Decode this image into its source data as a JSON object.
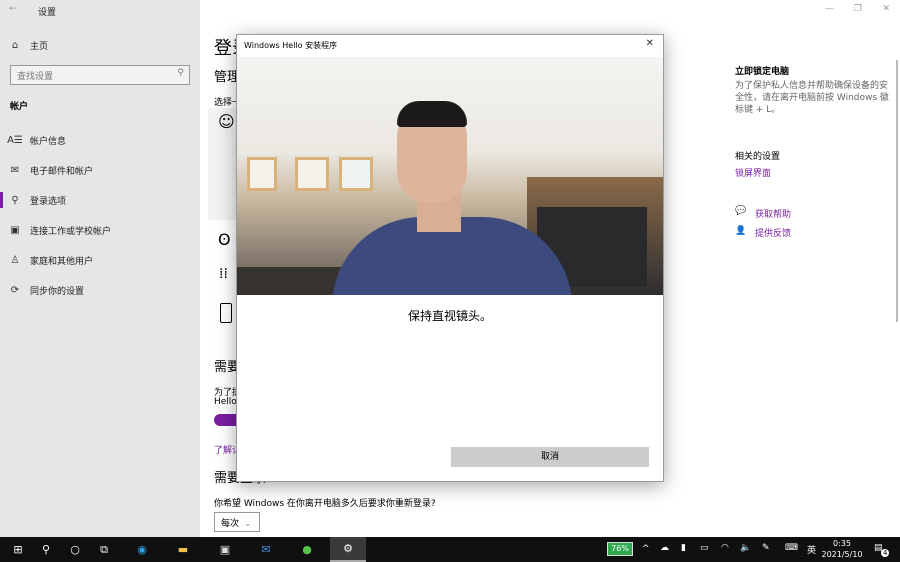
{
  "window": {
    "title": "设置",
    "back": "←",
    "min": "—",
    "restore": "❐",
    "close": "✕"
  },
  "sidebar": {
    "home": "主页",
    "search_placeholder": "查找设置",
    "section": "帐户",
    "items": [
      {
        "label": "帐户信息",
        "icon": "A☰"
      },
      {
        "label": "电子邮件和帐户",
        "icon": "✉"
      },
      {
        "label": "登录选项",
        "icon": "⚲"
      },
      {
        "label": "连接工作或学校帐户",
        "icon": "▣"
      },
      {
        "label": "家庭和其他用户",
        "icon": "♙"
      },
      {
        "label": "同步你的设置",
        "icon": "⟳"
      }
    ]
  },
  "main": {
    "title": "登录选项",
    "subtitle": "管理你登录设备的方式",
    "choose": "选择一个登录选项",
    "require": "需要",
    "require_text1": "为了提高安全性",
    "require_text2": "Hello",
    "learn": "了解详情",
    "require2": "需要登录",
    "question": "你希望 Windows 在你离开电脑多久后要求你重新登录?",
    "dropdown": "每次"
  },
  "right": {
    "lock_title": "立即锁定电脑",
    "lock_text": "为了保护私人信息并帮助确保设备的安全性，请在离开电脑前按 Windows 徽标键 + L。",
    "related": "相关的设置",
    "lockscreen": "锁屏界面",
    "help": "获取帮助",
    "feedback": "提供反馈"
  },
  "dialog": {
    "title": "Windows Hello 安装程序",
    "close": "✕",
    "instruction": "保持直视镜头。",
    "cancel": "取消"
  },
  "taskbar": {
    "battery": "76%",
    "caret": "^",
    "ime": "英",
    "time": "0:35",
    "date": "2021/5/10",
    "notifications": "4"
  },
  "colors": {
    "accent": "#7a1fa2"
  }
}
